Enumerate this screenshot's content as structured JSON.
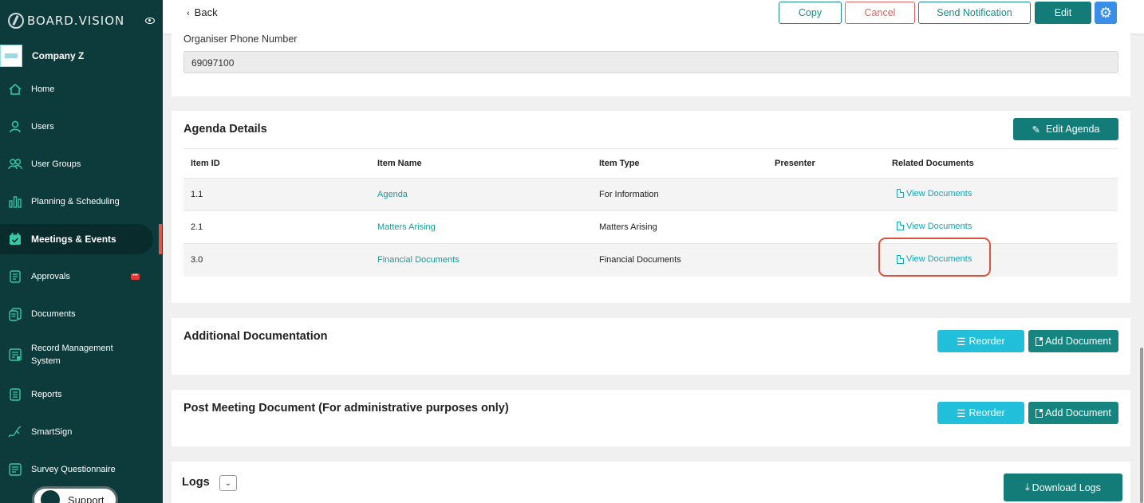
{
  "brand": {
    "name": "BOARD.VISION"
  },
  "company": {
    "name": "Company Z"
  },
  "nav": [
    {
      "label": "Home",
      "icon": "home-icon"
    },
    {
      "label": "Users",
      "icon": "user-icon"
    },
    {
      "label": "User Groups",
      "icon": "users-icon"
    },
    {
      "label": "Planning & Scheduling",
      "icon": "chart-icon"
    },
    {
      "label": "Meetings & Events",
      "icon": "calendar-icon",
      "active": true
    },
    {
      "label": "Approvals",
      "icon": "approvals-icon",
      "badge": "•••"
    },
    {
      "label": "Documents",
      "icon": "documents-icon"
    },
    {
      "label": "Record Management System",
      "icon": "records-icon"
    },
    {
      "label": "Reports",
      "icon": "reports-icon"
    },
    {
      "label": "SmartSign",
      "icon": "signature-icon"
    },
    {
      "label": "Survey Questionnaire",
      "icon": "survey-icon"
    }
  ],
  "support": {
    "label": "Support"
  },
  "topbar": {
    "back": "Back",
    "copy": "Copy",
    "cancel": "Cancel",
    "send_notification": "Send Notification",
    "edit": "Edit"
  },
  "organiser": {
    "phone_label": "Organiser Phone Number",
    "phone_value": "69097100"
  },
  "agenda": {
    "title": "Agenda Details",
    "edit_button": "Edit Agenda",
    "columns": [
      "Item ID",
      "Item Name",
      "Item Type",
      "Presenter",
      "Related Documents"
    ],
    "rows": [
      {
        "id": "1.1",
        "name": "Agenda",
        "type": "For Information",
        "presenter": "",
        "docs": "View Documents"
      },
      {
        "id": "2.1",
        "name": "Matters Arising",
        "type": "Matters Arising",
        "presenter": "",
        "docs": "View Documents"
      },
      {
        "id": "3.0",
        "name": "Financial Documents",
        "type": "Financial Documents",
        "presenter": "",
        "docs": "View Documents"
      }
    ]
  },
  "additional": {
    "title": "Additional Documentation",
    "reorder": "Reorder",
    "add_document": "Add Document"
  },
  "post_meeting": {
    "title": "Post Meeting Document (For administrative purposes only)",
    "reorder": "Reorder",
    "add_document": "Add Document"
  },
  "logs": {
    "title": "Logs",
    "download": "Download Logs"
  },
  "colors": {
    "sidebar_bg": "#0d3b3c",
    "teal": "#137b78",
    "cyan": "#21bfd9",
    "highlight": "#d9533f"
  }
}
